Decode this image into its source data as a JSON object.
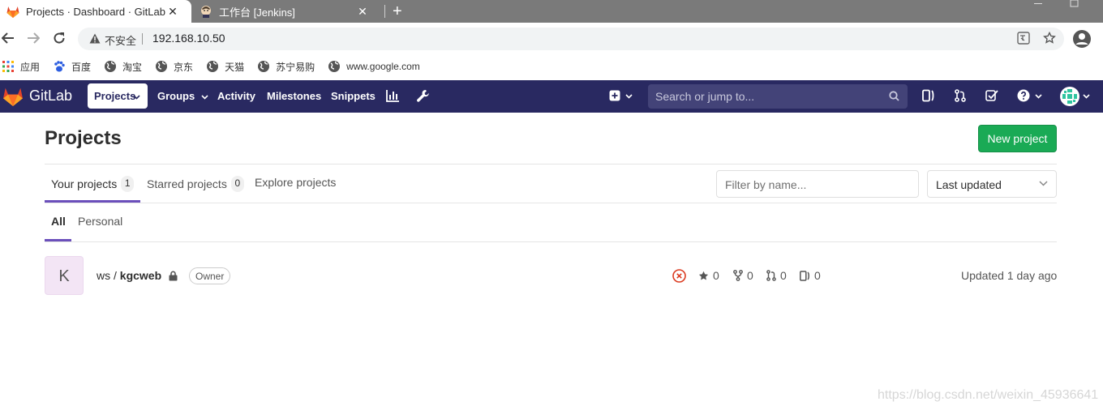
{
  "browser": {
    "tabs": [
      {
        "title": "Projects · Dashboard · GitLab",
        "icon": "gitlab-favicon",
        "active": true
      },
      {
        "title": "工作台 [Jenkins]",
        "icon": "jenkins-favicon",
        "active": false
      }
    ],
    "new_tab": "+",
    "close": "✕",
    "address": {
      "insecure_label": "不安全",
      "url": "192.168.10.50"
    },
    "bookmarks": [
      {
        "label": "应用",
        "icon": "apps-grid-icon"
      },
      {
        "label": "百度",
        "icon": "baidu-paw-icon"
      },
      {
        "label": "淘宝",
        "icon": "globe-icon"
      },
      {
        "label": "京东",
        "icon": "globe-icon"
      },
      {
        "label": "天猫",
        "icon": "globe-icon"
      },
      {
        "label": "苏宁易购",
        "icon": "globe-icon"
      },
      {
        "label": "www.google.com",
        "icon": "globe-icon"
      }
    ]
  },
  "gitlab": {
    "brand": "GitLab",
    "nav": {
      "projects": "Projects",
      "groups": "Groups",
      "activity": "Activity",
      "milestones": "Milestones",
      "snippets": "Snippets"
    },
    "search_placeholder": "Search or jump to...",
    "colors": {
      "header": "#292961",
      "accent": "#6b4fbb",
      "success": "#1aaa55"
    }
  },
  "page": {
    "title": "Projects",
    "new_project_button": "New project",
    "tabs": [
      {
        "label": "Your projects",
        "count": "1"
      },
      {
        "label": "Starred projects",
        "count": "0"
      },
      {
        "label": "Explore projects"
      }
    ],
    "filter_placeholder": "Filter by name...",
    "sort_selected": "Last updated",
    "subtabs": {
      "all": "All",
      "personal": "Personal"
    }
  },
  "projects": [
    {
      "avatar_letter": "K",
      "namespace": "ws / ",
      "name": "kgcweb",
      "role": "Owner",
      "pipeline_status": "failed",
      "stars": "0",
      "forks": "0",
      "merge_requests": "0",
      "issues": "0",
      "updated": "Updated 1 day ago"
    }
  ],
  "watermark": "https://blog.csdn.net/weixin_45936641"
}
